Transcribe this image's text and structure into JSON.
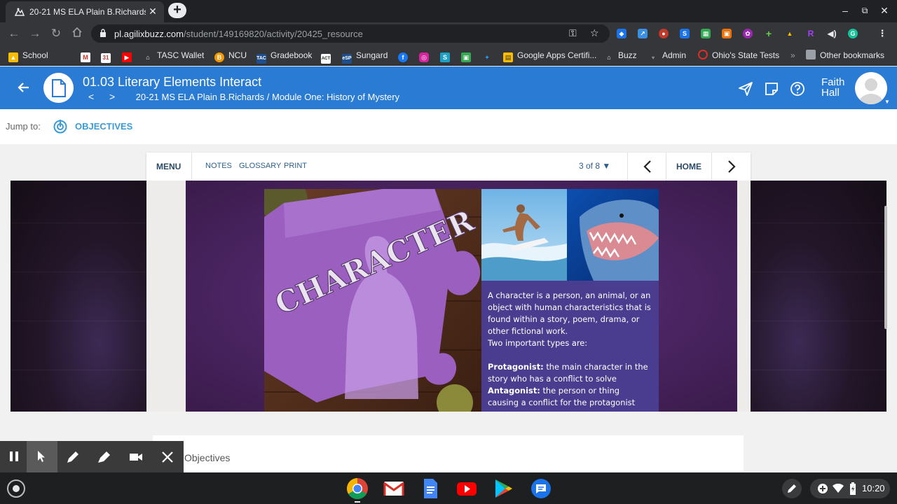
{
  "browser": {
    "tab_title": "20-21 MS ELA Plain B.Richards -",
    "url_host": "pl.agilixbuzz.com",
    "url_path": "/student/149169820/activity/20425_resource"
  },
  "bookmarks": {
    "items": [
      "School",
      "TASC Wallet",
      "NCU",
      "Gradebook",
      "Sungard",
      "Google Apps Certifi...",
      "Buzz",
      "Admin",
      "Ohio's State Tests"
    ],
    "overflow": "»",
    "other": "Other bookmarks"
  },
  "app": {
    "title": "01.03 Literary Elements Interact",
    "breadcrumb": "20-21 MS ELA Plain B.Richards / Module One: History of Mystery",
    "user_first": "Faith",
    "user_last": "Hall"
  },
  "jump": {
    "label": "Jump to:",
    "objectives": "OBJECTIVES"
  },
  "lesson_nav": {
    "menu": "MENU",
    "notes": "NOTES",
    "glossary": "GLOSSARY",
    "print": "PRINT",
    "page": "3 of 8 ▼",
    "home": "HOME"
  },
  "slide": {
    "image_word": "CHARACTER",
    "definition": "A character is a person, an animal, or an object with human characteristics that is found within a story, poem, drama, or other fictional work.",
    "types_intro": "Two important types are:",
    "protagonist_term": "Protagonist:",
    "protagonist_def": " the main character in the story who has a conflict to solve",
    "antagonist_term": "Antagonist:",
    "antagonist_def": " the person or thing causing a conflict for the protagonist"
  },
  "objectives_section": {
    "title": "Objectives"
  },
  "system": {
    "time": "10:20"
  },
  "colors": {
    "app_bar": "#2a7bd4",
    "link_blue": "#3a9bd5",
    "text_panel": "#4a3d8f",
    "slide_purple": "#4b2563"
  }
}
